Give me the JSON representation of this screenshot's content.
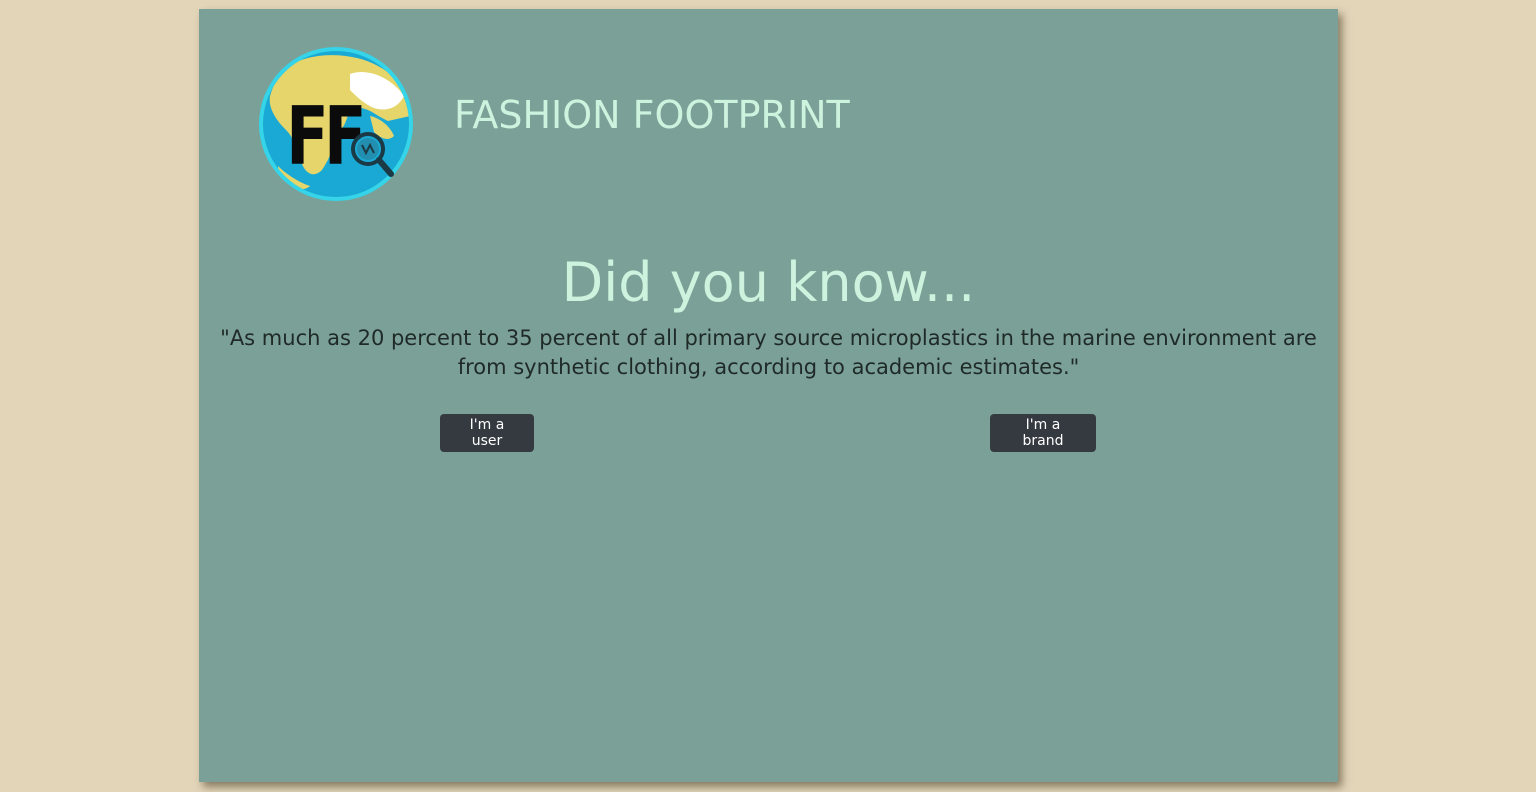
{
  "header": {
    "brand_title": "FASHION FOOTPRINT",
    "logo_text": "FF",
    "logo_icon": "globe-magnifier-logo"
  },
  "main": {
    "headline": "Did you know...",
    "quote": "\"As much as 20 percent to 35 percent of all primary source microplastics in the marine environment are from synthetic clothing, according to academic estimates.\""
  },
  "actions": {
    "user_label": "I'm a user",
    "brand_label": "I'm a brand"
  },
  "colors": {
    "page_background": "#e3d5b8",
    "card_background": "#7aa097",
    "title_color": "#cdf3de",
    "quote_color": "#1f2a27",
    "button_background": "#343a40",
    "button_text": "#ffffff"
  }
}
